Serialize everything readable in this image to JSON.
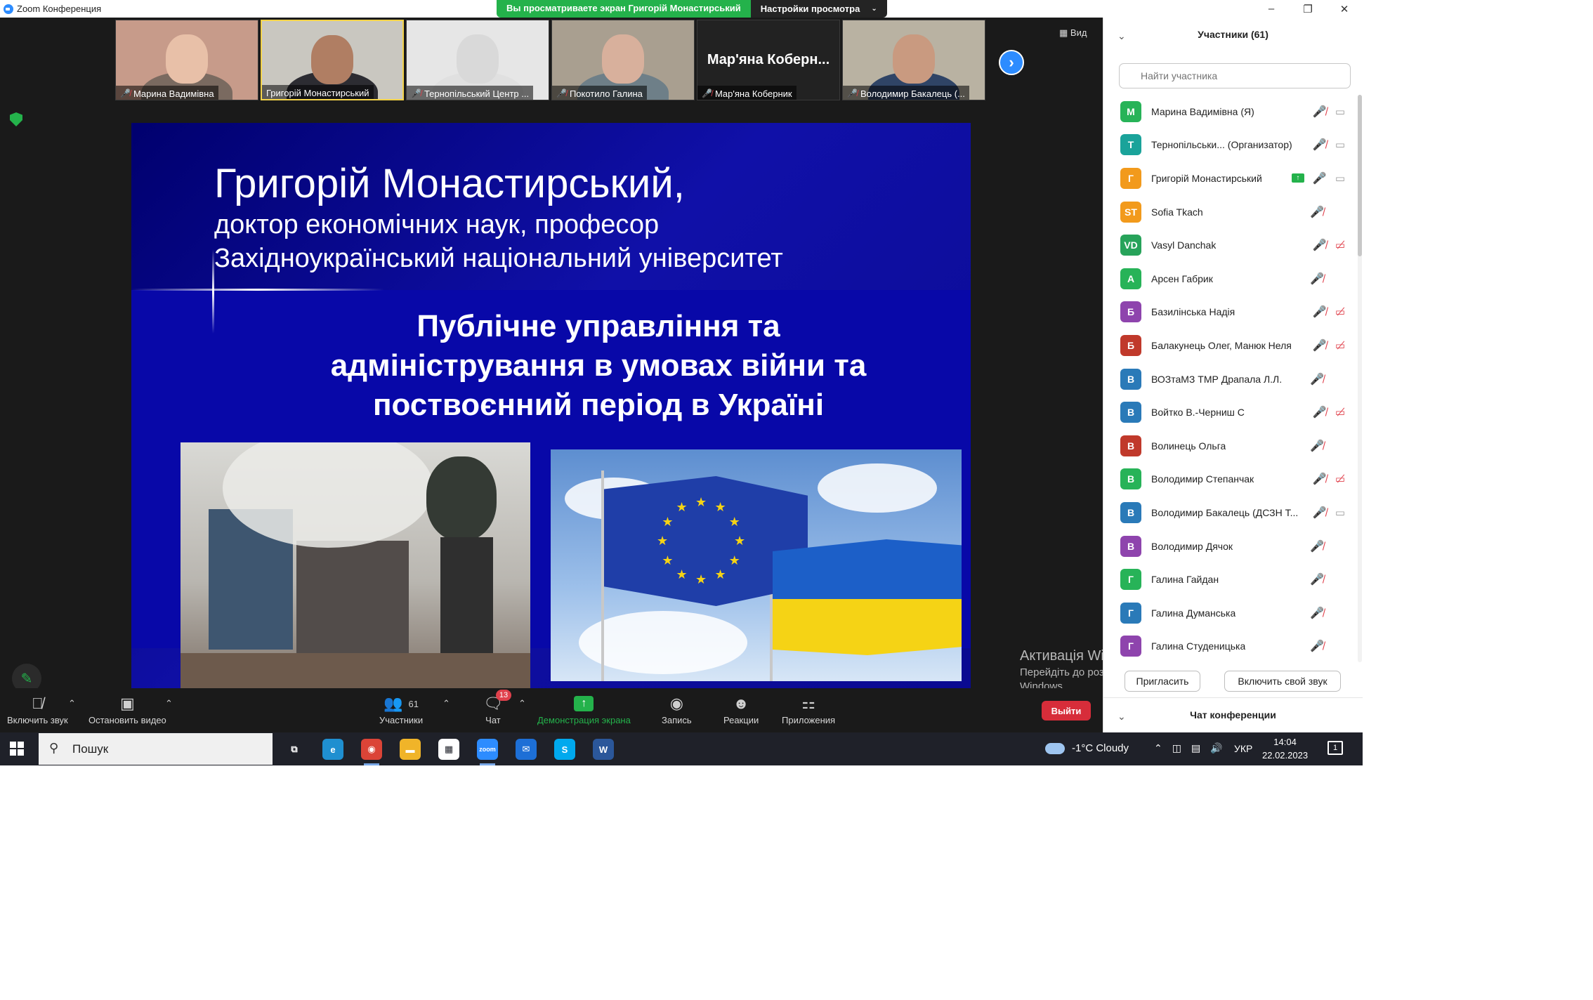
{
  "window": {
    "title": "Zoom Конференция",
    "share_banner": "Вы просматриваете экран Григорій Монастирський",
    "view_settings": "Настройки просмотра",
    "controls": [
      "–",
      "❐",
      "✕"
    ]
  },
  "thumbnails": [
    {
      "name": "Марина Вадимівна",
      "muted": true,
      "kind": "video",
      "skin": "#e8c0a8",
      "cloth": "#7a6a60",
      "bg": "#c79b8a"
    },
    {
      "name": "Григорій Монастирський",
      "muted": false,
      "kind": "video",
      "active": true,
      "skin": "#b07e63",
      "cloth": "#2c2c32",
      "bg": "#c9c7c0"
    },
    {
      "name": "Тернопільський Центр ...",
      "muted": true,
      "kind": "video",
      "skin": "#d9d9d9",
      "cloth": "#e0e0e0",
      "bg": "#e6e6e6"
    },
    {
      "name": "Покотило Галина",
      "muted": true,
      "kind": "video",
      "skin": "#d8b09c",
      "cloth": "#6e7f88",
      "bg": "#a99f90"
    },
    {
      "name": "Мар'яна Коберн...",
      "caption": "Мар'яна Коберник",
      "muted": true,
      "kind": "text"
    },
    {
      "name": "Володимир Бакалець (...",
      "muted": true,
      "kind": "video",
      "skin": "#c99a80",
      "cloth": "#2f4466",
      "bg": "#b9b2a2"
    }
  ],
  "view_label": "Вид",
  "slide": {
    "author": "Григорій Монастирський,",
    "degree": "доктор економічних наук, професор",
    "university": "Західноукраїнський національний університет",
    "topic": "Публічне управління та адміністрування в умовах війни та поствоєнний період в Україні"
  },
  "activation": {
    "title": "Активація Windows",
    "subtitle": "Перейдіть до розділу \"Настройки\", щоб активувати Windows."
  },
  "toolbar": {
    "unmute": "Включить звук",
    "video": "Остановить видео",
    "participants": "Участники",
    "participants_count": "61",
    "chat": "Чат",
    "chat_badge": "13",
    "share": "Демонстрация экрана",
    "record": "Запись",
    "reactions": "Реакции",
    "apps": "Приложения",
    "leave": "Выйти"
  },
  "panel": {
    "title": "Участники (61)",
    "search_placeholder": "Найти участника",
    "invite": "Пригласить",
    "unmute_me": "Включить свой звук",
    "chat_title": "Чат конференции",
    "participants": [
      {
        "initial": "М",
        "name": "Марина Вадимівна (Я)",
        "color": "#27b358",
        "mic": "off",
        "cam": "on"
      },
      {
        "initial": "Т",
        "name": "Тернопільськи... (Организатор)",
        "color": "#1aa39a",
        "mic": "off",
        "cam": "on"
      },
      {
        "initial": "Г",
        "name": "Григорій Монастирський",
        "color": "#f29a1c",
        "mic": "on",
        "cam": "on",
        "sharing": true
      },
      {
        "initial": "ST",
        "name": "Sofia Tkach",
        "color": "#f29a1c",
        "mic": "off",
        "cam": "none"
      },
      {
        "initial": "VD",
        "name": "Vasyl Danchak",
        "color": "#27a35a",
        "mic": "off",
        "cam": "off"
      },
      {
        "initial": "А",
        "name": "Арсен Габрик",
        "color": "#27b358",
        "mic": "off",
        "cam": "none"
      },
      {
        "initial": "Б",
        "name": "Базилінська Надія",
        "color": "#8e44ad",
        "mic": "off",
        "cam": "off"
      },
      {
        "initial": "Б",
        "name": "Балакунець Олег, Манюк Неля",
        "color": "#c0392b",
        "mic": "off",
        "cam": "off"
      },
      {
        "initial": "В",
        "name": "ВОЗтаМЗ ТМР Драпала Л.Л.",
        "color": "#2a7ab8",
        "mic": "off",
        "cam": "none"
      },
      {
        "initial": "В",
        "name": "Войтко В.-Черниш С",
        "color": "#2a7ab8",
        "mic": "off",
        "cam": "off"
      },
      {
        "initial": "В",
        "name": "Волинець Ольга",
        "color": "#c0392b",
        "mic": "off",
        "cam": "none"
      },
      {
        "initial": "В",
        "name": "Володимир Степанчак",
        "color": "#27b358",
        "mic": "off",
        "cam": "off"
      },
      {
        "initial": "В",
        "name": "Володимир Бакалець (ДСЗН Т...",
        "color": "#2a7ab8",
        "mic": "off",
        "cam": "on"
      },
      {
        "initial": "В",
        "name": "Володимир Дячок",
        "color": "#8e44ad",
        "mic": "off",
        "cam": "none"
      },
      {
        "initial": "Г",
        "name": "Галина Гайдан",
        "color": "#27b358",
        "mic": "off",
        "cam": "none"
      },
      {
        "initial": "Г",
        "name": "Галина Думанська",
        "color": "#2a7ab8",
        "mic": "off",
        "cam": "none"
      },
      {
        "initial": "Г",
        "name": "Галина Студеницька",
        "color": "#8e44ad",
        "mic": "off",
        "cam": "none"
      }
    ]
  },
  "taskbar": {
    "search": "Пошук",
    "weather": "-1°C  Cloudy",
    "lang": "УКР",
    "time": "14:04",
    "date": "22.02.2023",
    "notifications": "1",
    "apps": [
      {
        "name": "task-view",
        "label": "⧉",
        "color": "transparent"
      },
      {
        "name": "edge",
        "label": "e",
        "color": "#1f8fd0"
      },
      {
        "name": "chrome",
        "label": "◉",
        "color": "#db4437",
        "running": true
      },
      {
        "name": "explorer",
        "label": "▬",
        "color": "#f0b429"
      },
      {
        "name": "store",
        "label": "▦",
        "color": "#ffffff"
      },
      {
        "name": "zoom",
        "label": "zoom",
        "color": "#2d8cff",
        "running": true
      },
      {
        "name": "mail",
        "label": "✉",
        "color": "#1d6fd6"
      },
      {
        "name": "skype",
        "label": "S",
        "color": "#00a9ee"
      },
      {
        "name": "word",
        "label": "W",
        "color": "#2b579a"
      }
    ]
  }
}
